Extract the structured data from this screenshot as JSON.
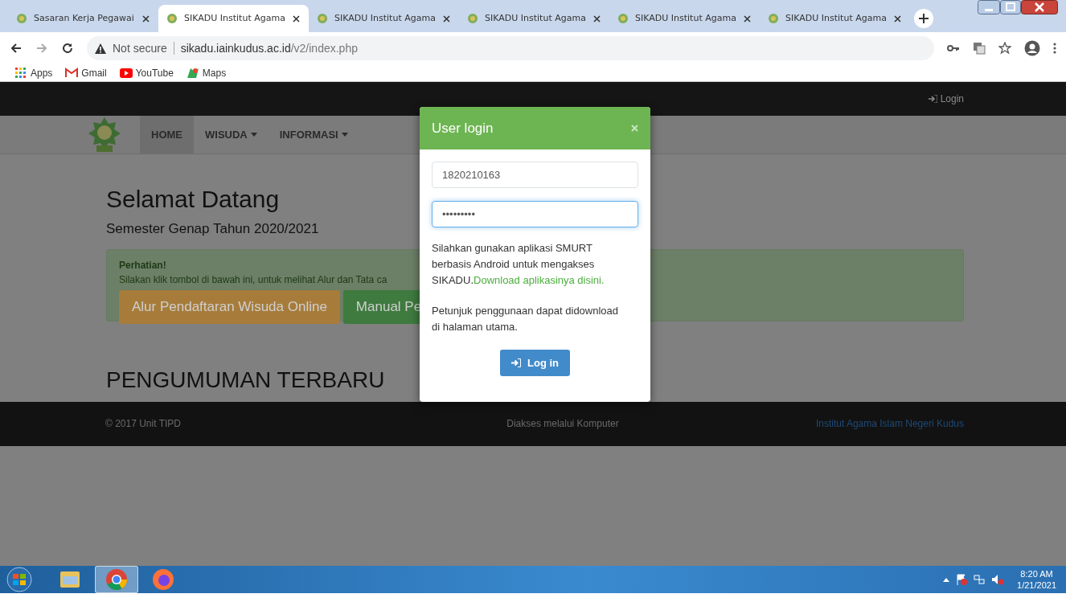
{
  "browser": {
    "tabs": [
      {
        "title": "Sasaran Kerja Pegawai",
        "selected": false
      },
      {
        "title": "SIKADU Institut Agama",
        "selected": true
      },
      {
        "title": "SIKADU Institut Agama",
        "selected": false
      },
      {
        "title": "SIKADU Institut Agama",
        "selected": false
      },
      {
        "title": "SIKADU Institut Agama",
        "selected": false
      },
      {
        "title": "SIKADU Institut Agama",
        "selected": false
      }
    ],
    "security": "Not secure",
    "url_host": "sikadu.iainkudus.ac.id",
    "url_path": "/v2/index.php",
    "bookmarks": [
      {
        "kind": "apps",
        "label": "Apps"
      },
      {
        "kind": "gmail",
        "label": "Gmail"
      },
      {
        "kind": "youtube",
        "label": "YouTube"
      },
      {
        "kind": "maps",
        "label": "Maps"
      }
    ]
  },
  "page": {
    "topbar_login": "Login",
    "nav": [
      {
        "label": "HOME",
        "selected": true,
        "dropdown": false
      },
      {
        "label": "WISUDA",
        "selected": false,
        "dropdown": true
      },
      {
        "label": "INFORMASI",
        "selected": false,
        "dropdown": true
      }
    ],
    "welcome_title": "Selamat Datang",
    "welcome_subtitle": "Semester Genap Tahun 2020/2021",
    "alert": {
      "title": "Perhatian!",
      "text": "Silakan klik tombol di bawah ini, untuk melihat Alur dan Tata ca",
      "buttons": [
        {
          "label": "Alur Pendaftaran Wisuda Online",
          "color": "#a77c3a"
        },
        {
          "label": "Manual Pe",
          "color": "#3f7a3f"
        }
      ]
    },
    "announcements_title": "PENGUMUMAN TERBARU",
    "footer": {
      "copyright": "© 2017 Unit TIPD",
      "access": "Diakses melalui Komputer",
      "institution": "Institut Agama Islam Negeri Kudus"
    }
  },
  "modal": {
    "title": "User login",
    "username": "1820210163",
    "password": "•••••••••",
    "password_focused": true,
    "info": "Silahkan gunakan aplikasi SMURT berbasis Android untuk mengakses SIKADU.",
    "info_link": "Download aplikasinya disini.",
    "hint": "Petunjuk penggunaan dapat didownload di halaman utama.",
    "button": "Log in"
  },
  "taskbar": {
    "apps": [
      {
        "kind": "explorer",
        "selected": false
      },
      {
        "kind": "chrome",
        "selected": true
      },
      {
        "kind": "firefox",
        "selected": false
      }
    ],
    "time": "8:20 AM",
    "date": "1/21/2021"
  }
}
